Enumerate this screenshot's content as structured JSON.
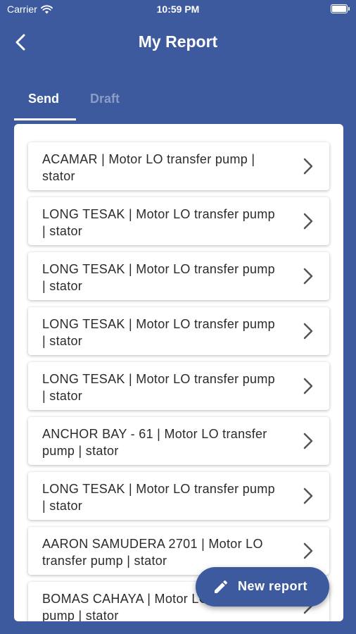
{
  "status_bar": {
    "carrier": "Carrier",
    "time": "10:59 PM",
    "icons": [
      "wifi-icon",
      "battery-icon"
    ]
  },
  "header": {
    "title": "My Report",
    "back_icon": "chevron-left-icon"
  },
  "tabs": [
    {
      "label": "Send",
      "active": true
    },
    {
      "label": "Draft",
      "active": false
    }
  ],
  "reports": [
    {
      "text": "ACAMAR | Motor LO transfer pump | stator"
    },
    {
      "text": "LONG TESAK | Motor LO transfer pump | stator"
    },
    {
      "text": "LONG TESAK | Motor LO transfer pump | stator"
    },
    {
      "text": "LONG TESAK | Motor LO transfer pump | stator"
    },
    {
      "text": "LONG TESAK | Motor LO transfer pump | stator"
    },
    {
      "text": "ANCHOR BAY - 61 | Motor LO transfer pump | stator"
    },
    {
      "text": "LONG TESAK | Motor LO transfer pump | stator"
    },
    {
      "text": "AARON SAMUDERA 2701 | Motor LO transfer pump | stator"
    },
    {
      "text": "BOMAS CAHAYA | Motor LO transfer pump | stator"
    }
  ],
  "fab": {
    "label": "New report",
    "icon": "pencil-icon"
  },
  "colors": {
    "brand": "#3d5a9e",
    "inactive_tab": "#8b9cc6",
    "card_bg": "#ffffff",
    "text": "#2b2b2b"
  }
}
